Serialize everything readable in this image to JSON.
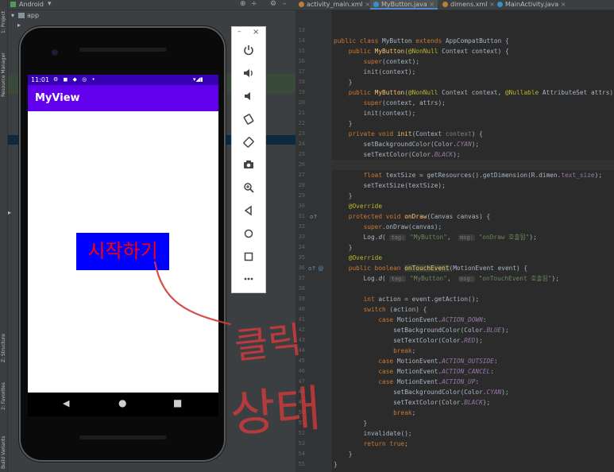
{
  "project_panel": {
    "view_mode": "Android",
    "tree": {
      "app_label": "app"
    },
    "vertical_tabs": [
      "1: Project",
      "Resource Manager",
      "Z: Structure",
      "2: Favorites",
      "Build Variants"
    ]
  },
  "editor": {
    "tabs": [
      {
        "label": "activity_main.xml",
        "active": false
      },
      {
        "label": "MyButton.java",
        "active": true
      },
      {
        "label": "dimens.xml",
        "active": false
      },
      {
        "label": "MainActivity.java",
        "active": false
      }
    ],
    "first_line_number": 13,
    "line_numbers": [
      "13",
      "14",
      "15",
      "16",
      "17",
      "18",
      "19",
      "20",
      "21",
      "22",
      "23",
      "24",
      "25",
      "26",
      "27",
      "28",
      "29",
      "30",
      "31",
      "32",
      "33",
      "34",
      "35",
      "36",
      "37",
      "38",
      "39",
      "40",
      "41",
      "42",
      "43",
      "44",
      "45",
      "46",
      "47",
      "48",
      "49",
      "50",
      "51",
      "52",
      "53",
      "54",
      "55"
    ]
  },
  "device": {
    "status_time": "11:01",
    "app_title": "MyView",
    "button_label": "시작하기"
  },
  "emulator_toolbar": {
    "window_controls": [
      "–",
      "×"
    ],
    "buttons": [
      "power-icon",
      "volume-up-icon",
      "volume-down-icon",
      "rotate-left-icon",
      "rotate-right-icon",
      "screenshot-icon",
      "zoom-icon",
      "back-icon",
      "home-icon",
      "overview-icon",
      "more-icon"
    ]
  },
  "annotation": {
    "text_line1": "클릭",
    "text_line2": "상태"
  },
  "colors": {
    "app_bar": "#6200ee",
    "status_bar": "#3700b3",
    "button_bg": "#0000ff",
    "button_text": "#ff0000",
    "annotation": "#d23a3a"
  }
}
